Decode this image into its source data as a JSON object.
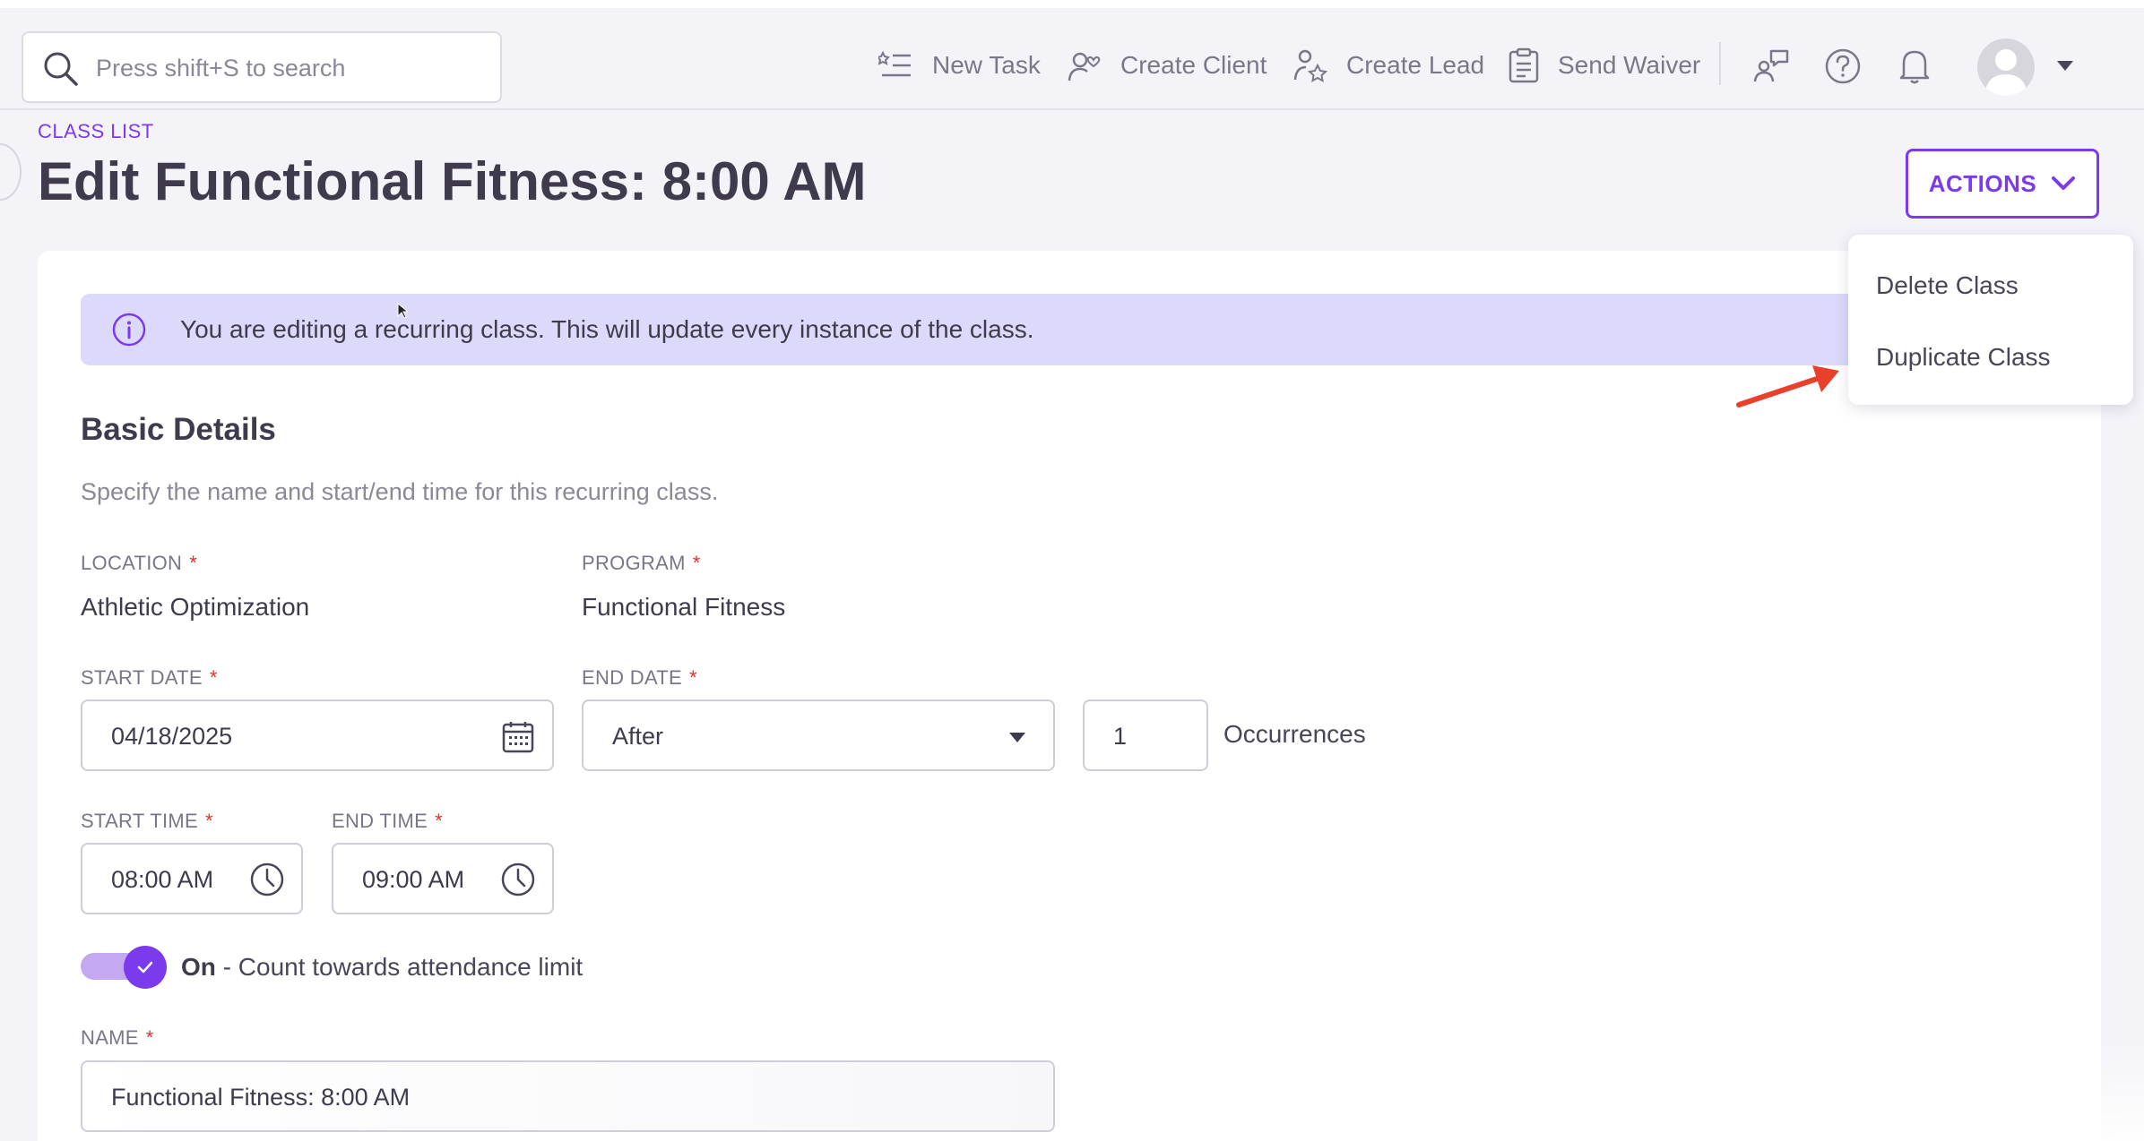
{
  "topbar": {
    "search_placeholder": "Press shift+S to search",
    "new_task": "New Task",
    "create_client": "Create Client",
    "create_lead": "Create Lead",
    "send_waiver": "Send Waiver"
  },
  "header": {
    "breadcrumb": "CLASS LIST",
    "title": "Edit Functional Fitness: 8:00 AM",
    "actions_label": "ACTIONS"
  },
  "actions_menu": {
    "items": [
      "Delete Class",
      "Duplicate Class"
    ]
  },
  "banner": {
    "text": "You are editing a recurring class. This will update every instance of the class."
  },
  "basic_details": {
    "heading": "Basic Details",
    "description": "Specify the name and start/end time for this recurring class.",
    "location_label": "LOCATION",
    "location_value": "Athletic Optimization",
    "program_label": "PROGRAM",
    "program_value": "Functional Fitness",
    "start_date_label": "START DATE",
    "start_date_value": "04/18/2025",
    "end_date_label": "END DATE",
    "end_date_value": "After",
    "occurrences_value": "1",
    "occurrences_label": "Occurrences",
    "start_time_label": "START TIME",
    "start_time_value": "08:00 AM",
    "end_time_label": "END TIME",
    "end_time_value": "09:00 AM",
    "toggle_state": "On",
    "toggle_text": " - Count towards attendance limit",
    "name_label": "NAME",
    "name_value": "Functional Fitness: 8:00 AM",
    "required_mark": "*"
  },
  "colors": {
    "accent": "#7c3aed",
    "banner_bg": "#dcd9fb",
    "required": "#e0312f",
    "annotation_arrow": "#e8402a"
  }
}
